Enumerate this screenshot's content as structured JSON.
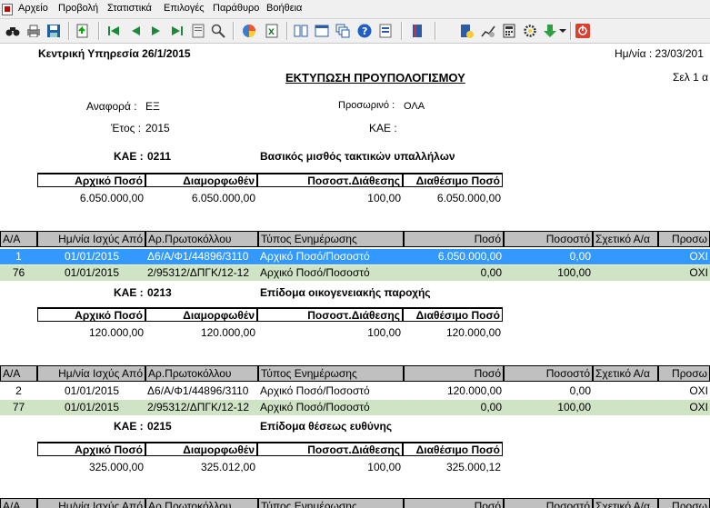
{
  "menu": [
    "Αρχείο",
    "Προβολή",
    "Στατιστικά",
    "Επιλογές",
    "Παράθυρο",
    "Βοήθεια"
  ],
  "report": {
    "org": "Κεντρική Υπηρεσία 26/1/2015",
    "date_label": "Ημ/νία : 23/03/201",
    "title": "ΕΚΤΥΠΩΣΗ ΠΡΟΥΠΟΛΟΓΙΣΜΟΥ",
    "page_label": "Σελ 1 α",
    "anafora_label": "Αναφορά :",
    "anafora_value": "ΕΞ",
    "etos_label": "Έτος :",
    "etos_value": "2015",
    "prosorino_label": "Προσωρινό :",
    "prosorino_value": "ΟΛΑ",
    "kae_label": "ΚΑΕ :",
    "kae_value": ""
  },
  "sum_headers": [
    "Αρχικό Ποσό",
    "Διαμορφωθέν",
    "Ποσοστ.Διάθεσης",
    "Διαθέσιμο Ποσό"
  ],
  "table_headers": [
    "Α/Α",
    "Ημ/νία Ισχύς Από",
    "Αρ.Πρωτοκόλλου",
    "Τύπος Ενημέρωσης",
    "Ποσό",
    "Ποσοστό",
    "Σχετικό Α/α",
    "Προσω"
  ],
  "sections": [
    {
      "kae_label": "ΚΑΕ :",
      "kae": "0211",
      "desc": "Βασικός μισθός τακτικών υπαλλήλων",
      "sums": [
        "6.050.000,00",
        "6.050.000,00",
        "100,00",
        "6.050.000,00"
      ],
      "rows": [
        [
          "1",
          "01/01/2015",
          "Δ6/Α/Φ1/44896/3110",
          "Αρχικό Ποσό/Ποσοστό",
          "6.050.000,00",
          "0,00",
          "",
          "ΟΧΙ"
        ],
        [
          "76",
          "01/01/2015",
          "2/95312/ΔΠΓΚ/12-12",
          "Αρχικό Ποσό/Ποσοστό",
          "0,00",
          "100,00",
          "",
          "ΟΧΙ"
        ]
      ]
    },
    {
      "kae_label": "ΚΑΕ :",
      "kae": "0213",
      "desc": "Επίδομα οικογενειακής παροχής",
      "sums": [
        "120.000,00",
        "120.000,00",
        "100,00",
        "120.000,00"
      ],
      "rows": [
        [
          "2",
          "01/01/2015",
          "Δ6/Α/Φ1/44896/3110",
          "Αρχικό Ποσό/Ποσοστό",
          "120.000,00",
          "0,00",
          "",
          "ΟΧΙ"
        ],
        [
          "77",
          "01/01/2015",
          "2/95312/ΔΠΓΚ/12-12",
          "Αρχικό Ποσό/Ποσοστό",
          "0,00",
          "100,00",
          "",
          "ΟΧΙ"
        ]
      ]
    },
    {
      "kae_label": "ΚΑΕ :",
      "kae": "0215",
      "desc": "Επίδομα θέσεως ευθύνης",
      "sums": [
        "325.000,00",
        "325.012,00",
        "100,00",
        "325.000,12"
      ],
      "rows": []
    }
  ],
  "colors": {
    "selected_row": "#3399ff",
    "alt_row": "#cfe3c5",
    "header_gray": "#c0c0c0"
  }
}
